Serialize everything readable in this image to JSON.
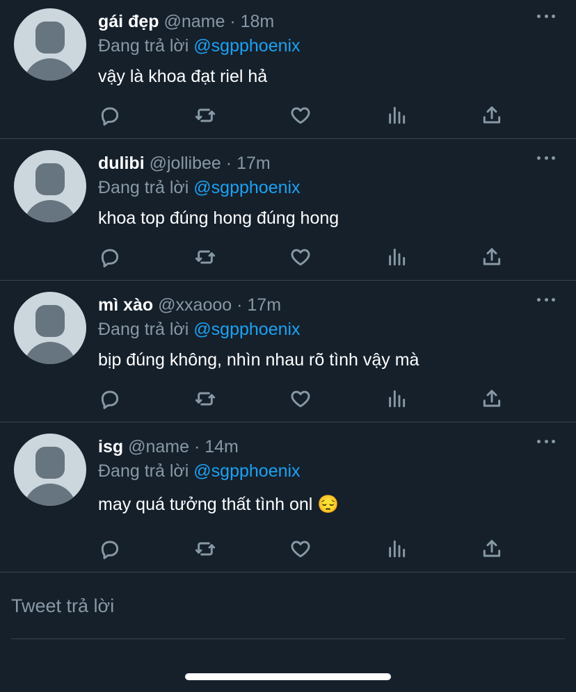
{
  "tweets": [
    {
      "name": "gái đẹp",
      "handle": "@name",
      "dot": "·",
      "time": "18m",
      "reply_prefix": "Đang trả lời",
      "reply_mention": "@sgpphoenix",
      "text": "vậy là khoa đạt riel hả"
    },
    {
      "name": "dulibi",
      "handle": "@jollibee",
      "dot": "·",
      "time": "17m",
      "reply_prefix": "Đang trả lời",
      "reply_mention": "@sgpphoenix",
      "text": "khoa top đúng hong đúng hong"
    },
    {
      "name": "mì xào",
      "handle": "@xxaooo",
      "dot": "·",
      "time": "17m",
      "reply_prefix": "Đang trả lời",
      "reply_mention": "@sgpphoenix",
      "text": "bịp đúng không, nhìn nhau rõ tình vậy mà"
    },
    {
      "name": "isg",
      "handle": "@name",
      "dot": "·",
      "time": "14m",
      "reply_prefix": "Đang trả lời",
      "reply_mention": "@sgpphoenix",
      "text": "may quá tưởng thất tình onl 😔"
    }
  ],
  "icons": [
    "more-icon",
    "reply-icon",
    "retweet-icon",
    "like-icon",
    "analytics-icon",
    "share-icon"
  ],
  "compose": {
    "placeholder": "Tweet trả lời"
  },
  "colors": {
    "background": "#15202b",
    "secondary_text": "#8899a6",
    "mention": "#1da1f2",
    "divider": "#38444d"
  }
}
